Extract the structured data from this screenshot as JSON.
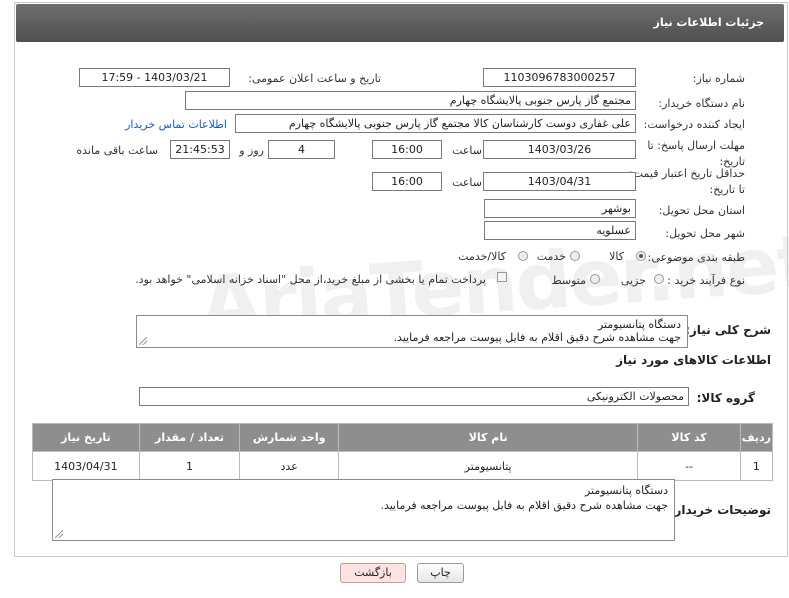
{
  "header": {
    "title": "جزئیات اطلاعات نیاز"
  },
  "form": {
    "need_number_label": "شماره نیاز:",
    "need_number": "1103096783000257",
    "announce_label": "تاریخ و ساعت اعلان عمومی:",
    "announce_value": "1403/03/21 - 17:59",
    "buyer_org_label": "نام دستگاه خریدار:",
    "buyer_org": "مجتمع گاز پارس جنوبی  پالایشگاه چهارم",
    "creator_label": "ایجاد کننده درخواست:",
    "creator": "علی غفاری دوست کارشناسان کالا مجتمع گاز پارس جنوبی  پالایشگاه چهارم",
    "buyer_contact_link": "اطلاعات تماس خریدار",
    "reply_deadline_label": "مهلت ارسال پاسخ: تا تاریخ:",
    "reply_date": "1403/03/26",
    "time_label": "ساعت",
    "reply_time": "16:00",
    "days_value": "4",
    "days_label": "روز و",
    "remaining_time": "21:45:53",
    "remaining_label": "ساعت باقی مانده",
    "validity_label": "حداقل تاریخ اعتبار قیمت: تا تاریخ:",
    "validity_date": "1403/04/31",
    "validity_time": "16:00",
    "province_label": "استان محل تحویل:",
    "province": "بوشهر",
    "city_label": "شهر محل تحویل:",
    "city": "عسلویه",
    "category_label": "طبقه بندی موضوعی:",
    "category_options": [
      "کالا",
      "خدمت",
      "کالا/خدمت"
    ],
    "category_selected": "کالا",
    "process_label": "نوع فرآیند خرید :",
    "process_options": [
      "جزیی",
      "متوسط"
    ],
    "payment_note": "پرداخت تمام یا بخشی از مبلغ خرید،از محل \"اسناد خزانه اسلامی\" خواهد بود."
  },
  "description": {
    "label": "شرح کلی نیاز:",
    "line1": "دستگاه پتانسیومتر",
    "line2": "جهت مشاهده شرح دقیق اقلام به فایل پیوست مراجعه فرمایید."
  },
  "goods_section_title": "اطلاعات کالاهای مورد نیاز",
  "goods_group": {
    "label": "گروه کالا:",
    "value": "محصولات الکترونیکی"
  },
  "table": {
    "headers": [
      "ردیف",
      "کد کالا",
      "نام کالا",
      "واحد شمارش",
      "تعداد / مقدار",
      "تاریخ نیاز"
    ],
    "rows": [
      [
        "1",
        "--",
        "پتانسیومتر",
        "عدد",
        "1",
        "1403/04/31"
      ]
    ]
  },
  "buyer_notes": {
    "label": "توضیحات خریدار:",
    "line1": "دستگاه پتانسیومتر",
    "line2": "جهت مشاهده شرح دقیق اقلام به فایل پیوست مراجعه فرمایید."
  },
  "buttons": {
    "print": "چاپ",
    "back": "بازگشت"
  },
  "watermark": "AriaTender.net",
  "colors": {
    "header_bg": "#5a5a5a",
    "link": "#1a5db5",
    "back_button_bg": "#fde2e2"
  }
}
